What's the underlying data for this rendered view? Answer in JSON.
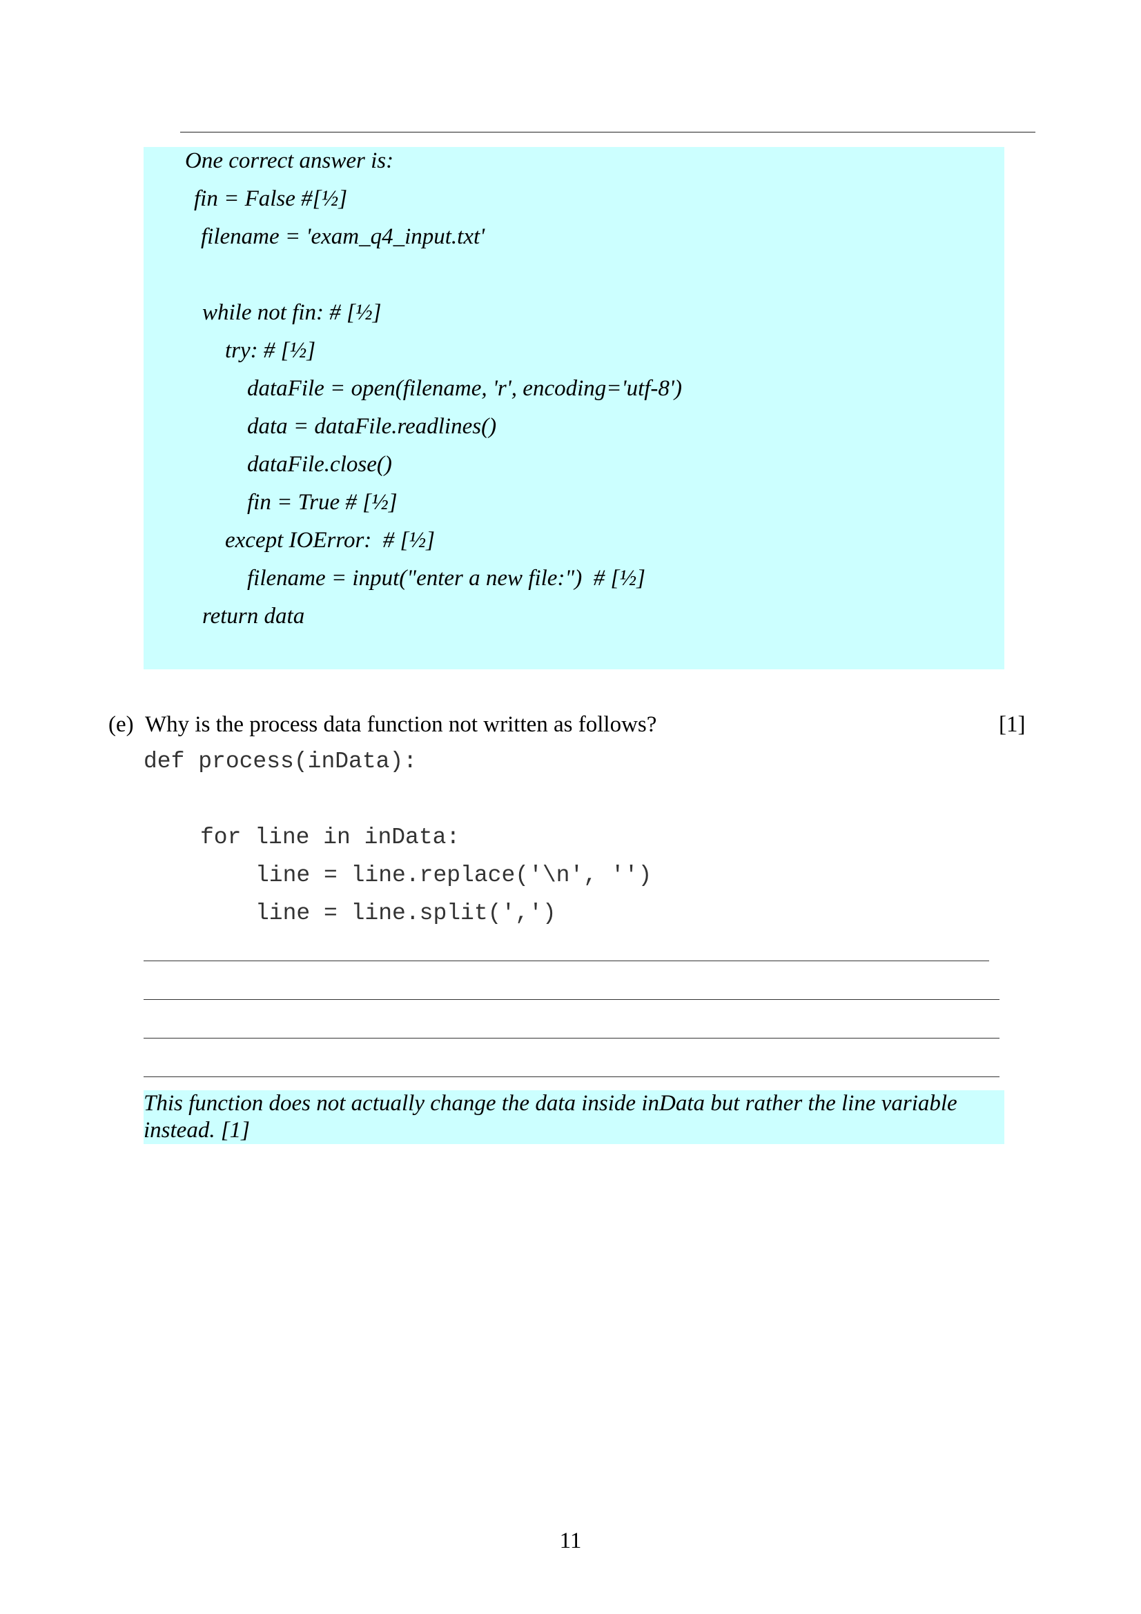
{
  "answer_box": {
    "lines": [
      "One correct answer is:",
      "fin = False #[½]",
      "filename = 'exam_q4_input.txt'",
      "while not fin: # [½]",
      "try: # [½]",
      "dataFile = open(filename, 'r', encoding='utf-8')",
      "data = dataFile.readlines()",
      "dataFile.close()",
      "fin = True # [½]",
      "except IOError:  # [½]",
      "filename = input(\"enter a new file:\")  # [½]",
      "return data"
    ]
  },
  "question": {
    "label": "(e)",
    "text": "Why is the process data function not written as follows?",
    "marks": "[1]",
    "code_lines": [
      "def process(inData):",
      "for line in inData:",
      "line = line.replace('\\n', '')",
      "line = line.split(',')"
    ]
  },
  "feedback": {
    "text": "This function does not actually change the data inside inData but rather the line variable instead. [1]"
  },
  "page": {
    "number": "11"
  }
}
